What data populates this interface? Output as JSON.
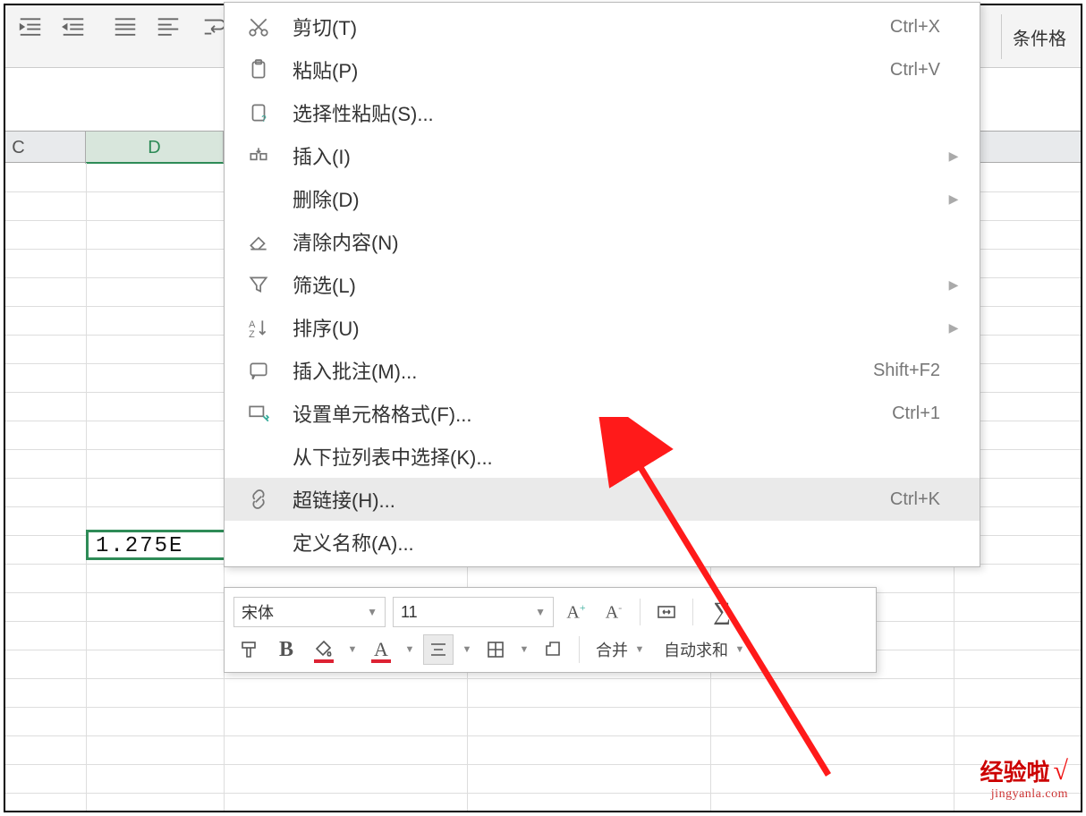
{
  "ribbon": {
    "button_conditional": "条件格"
  },
  "columns": {
    "c": "C",
    "d": "D"
  },
  "cell": {
    "value": "1.275E"
  },
  "context_menu": {
    "cut": {
      "label": "剪切(T)",
      "shortcut": "Ctrl+X"
    },
    "paste": {
      "label": "粘贴(P)",
      "shortcut": "Ctrl+V"
    },
    "paste_special": {
      "label": "选择性粘贴(S)...",
      "shortcut": ""
    },
    "insert": {
      "label": "插入(I)",
      "shortcut": ""
    },
    "delete": {
      "label": "删除(D)",
      "shortcut": ""
    },
    "clear": {
      "label": "清除内容(N)",
      "shortcut": ""
    },
    "filter": {
      "label": "筛选(L)",
      "shortcut": ""
    },
    "sort": {
      "label": "排序(U)",
      "shortcut": ""
    },
    "insert_comment": {
      "label": "插入批注(M)...",
      "shortcut": "Shift+F2"
    },
    "format_cells": {
      "label": "设置单元格格式(F)...",
      "shortcut": "Ctrl+1"
    },
    "pick_from_list": {
      "label": "从下拉列表中选择(K)...",
      "shortcut": ""
    },
    "hyperlink": {
      "label": "超链接(H)...",
      "shortcut": "Ctrl+K"
    },
    "define_name": {
      "label": "定义名称(A)...",
      "shortcut": ""
    }
  },
  "mini_toolbar": {
    "font_name": "宋体",
    "font_size": "11",
    "merge_label": "合并",
    "autosum_label": "自动求和"
  },
  "watermark": {
    "line1": "经验啦",
    "line2": "jingyanla.com"
  }
}
